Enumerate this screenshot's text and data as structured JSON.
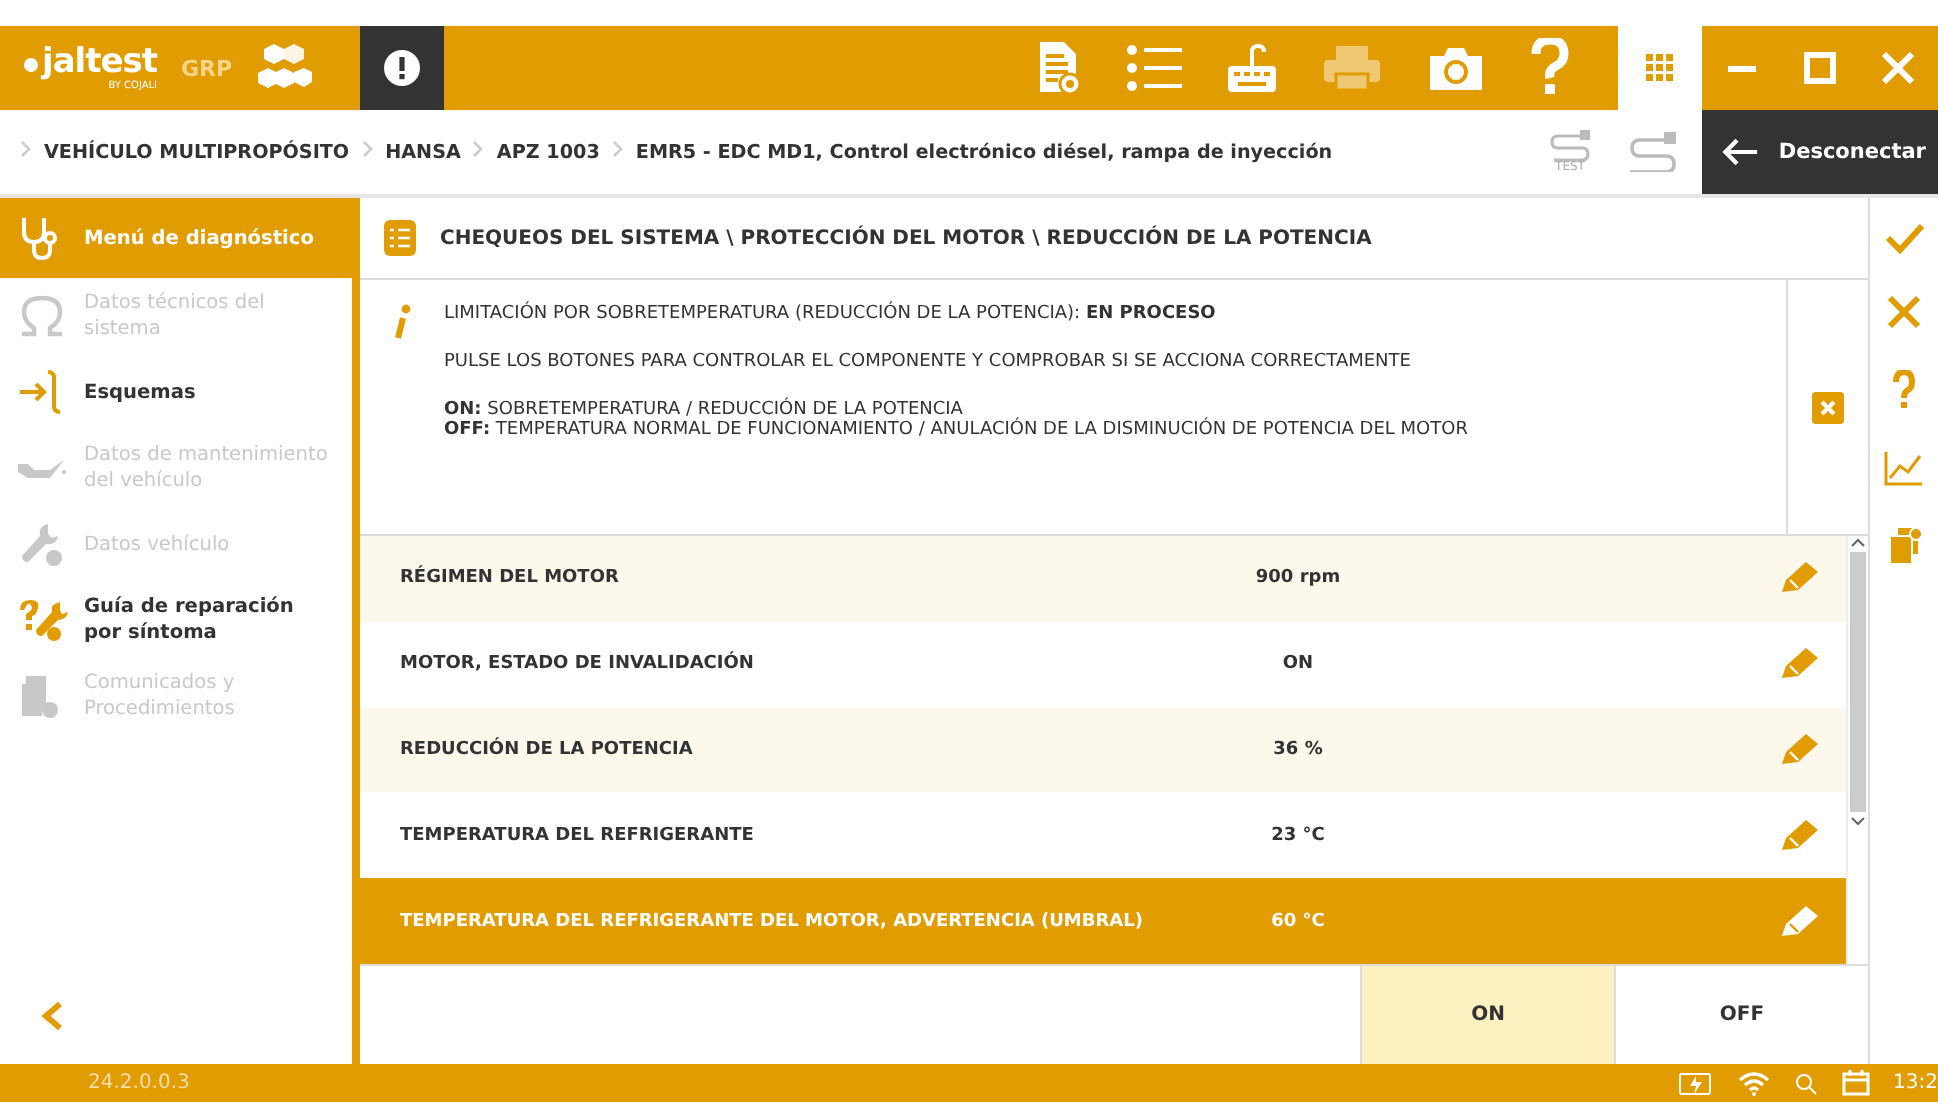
{
  "app": {
    "logo": "jaltest",
    "logo_sub": "BY COJALI",
    "edition": "GRP"
  },
  "breadcrumb": [
    "VEHÍCULO MULTIPROPÓSITO",
    "HANSA",
    "APZ 1003",
    "EMR5 - EDC MD1, Control electrónico diésel, rampa de inyección"
  ],
  "test_badge": "TEST",
  "disconnect_button": "Desconectar",
  "sidebar": {
    "items": [
      {
        "label": "Menú de diagnóstico",
        "selected": true,
        "disabled": false
      },
      {
        "label": "Datos técnicos del sistema",
        "selected": false,
        "disabled": true
      },
      {
        "label": "Esquemas",
        "selected": false,
        "disabled": false
      },
      {
        "label": "Datos de mantenimiento del vehículo",
        "selected": false,
        "disabled": true
      },
      {
        "label": "Datos vehículo",
        "selected": false,
        "disabled": true
      },
      {
        "label": "Guía de reparación por síntoma",
        "selected": false,
        "disabled": false
      },
      {
        "label": "Comunicados y Procedimientos",
        "selected": false,
        "disabled": true
      }
    ]
  },
  "section_title": "CHEQUEOS DEL SISTEMA \\ PROTECCIÓN DEL MOTOR \\ REDUCCIÓN DE LA POTENCIA",
  "info": {
    "lines": [
      "LIMITACIÓN POR SOBRETEMPERATURA (REDUCCIÓN DE LA POTENCIA): **EN PROCESO**",
      "PULSE LOS BOTONES PARA CONTROLAR EL COMPONENTE Y COMPROBAR SI SE ACCIONA CORRECTAMENTE"
    ],
    "legend": [
      "**ON:** SOBRETEMPERATURA / REDUCCIÓN DE LA POTENCIA",
      "**OFF:** TEMPERATURA NORMAL DE FUNCIONAMIENTO / ANULACIÓN DE LA DISMINUCIÓN DE POTENCIA DEL MOTOR"
    ]
  },
  "table": {
    "rows": [
      {
        "name": "RÉGIMEN DEL MOTOR",
        "value": "900 rpm",
        "selected": false
      },
      {
        "name": "MOTOR, ESTADO DE INVALIDACIÓN",
        "value": "ON",
        "selected": false
      },
      {
        "name": "REDUCCIÓN DE LA POTENCIA",
        "value": "36 %",
        "selected": false
      },
      {
        "name": "TEMPERATURA DEL REFRIGERANTE",
        "value": "23 °C",
        "selected": false
      },
      {
        "name": "TEMPERATURA DEL REFRIGERANTE DEL MOTOR, ADVERTENCIA (UMBRAL)",
        "value": "60 °C",
        "selected": true
      }
    ]
  },
  "actions": [
    {
      "label": "ON",
      "selected": true
    },
    {
      "label": "OFF",
      "selected": false
    }
  ],
  "status_bar": {
    "version": "24.2.0.0.3",
    "time": "13:2"
  }
}
